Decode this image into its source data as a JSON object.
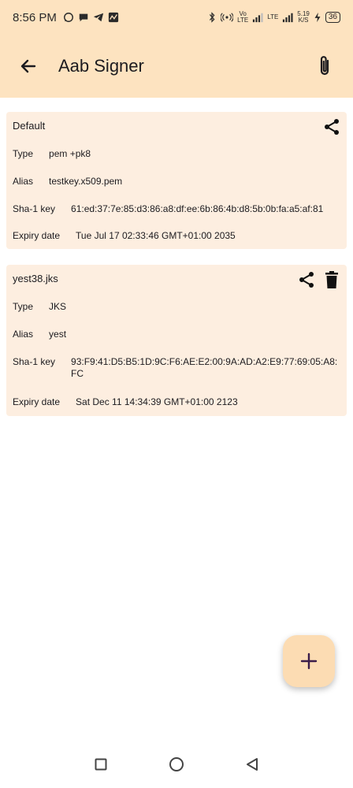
{
  "status_bar": {
    "time": "8:56 PM",
    "vo_lte_top": "Vo",
    "vo_lte_bottom": "LTE",
    "lte_label": "LTE",
    "speed_top": "5.19",
    "speed_bottom": "K/S",
    "battery": "36"
  },
  "app_bar": {
    "title": "Aab Signer"
  },
  "cards": [
    {
      "title": "Default",
      "type_label": "Type",
      "type_value": "pem +pk8",
      "alias_label": "Alias",
      "alias_value": "testkey.x509.pem",
      "sha_label": "Sha-1 key",
      "sha_value": "61:ed:37:7e:85:d3:86:a8:df:ee:6b:86:4b:d8:5b:0b:fa:a5:af:81",
      "expiry_label": "Expiry date",
      "expiry_value": "Tue Jul 17 02:33:46 GMT+01:00 2035"
    },
    {
      "title": "yest38.jks",
      "type_label": "Type",
      "type_value": "JKS",
      "alias_label": "Alias",
      "alias_value": "yest",
      "sha_label": "Sha-1 key",
      "sha_value": "93:F9:41:D5:B5:1D:9C:F6:AE:E2:00:9A:AD:A2:E9:77:69:05:A8:FC",
      "expiry_label": "Expiry date",
      "expiry_value": "Sat Dec 11 14:34:39 GMT+01:00 2123"
    }
  ],
  "colors": {
    "app_bar": "#fde3c0",
    "card": "#fdeee0",
    "fab": "#fcdcb3",
    "fab_icon": "#3b1c4a"
  },
  "icons": {
    "back": "arrow-back-icon",
    "attach": "paperclip-icon",
    "share": "share-icon",
    "delete": "trash-icon",
    "add": "plus-icon"
  }
}
